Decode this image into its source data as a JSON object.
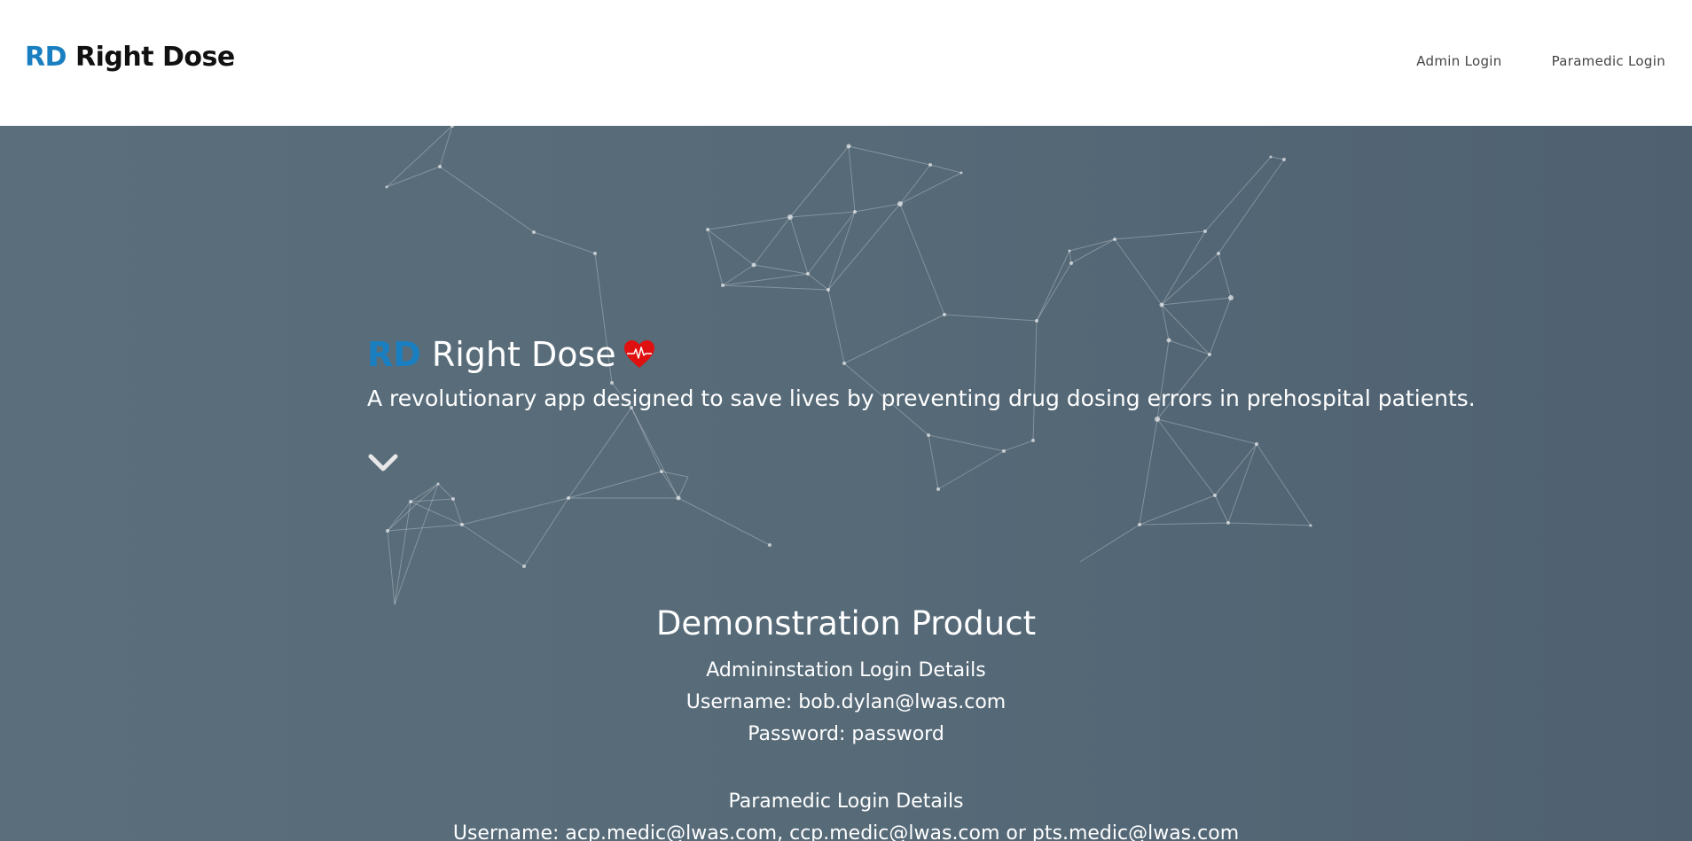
{
  "header": {
    "brand_rd": "RD",
    "brand_name": "Right Dose",
    "nav": {
      "admin_login": "Admin Login",
      "paramedic_login": "Paramedic Login"
    }
  },
  "hero": {
    "title_rd": "RD",
    "title_name": "Right Dose",
    "subtitle": "A revolutionary app designed to save lives by preventing drug dosing errors in prehospital patients."
  },
  "demo": {
    "heading": "Demonstration Product",
    "admin_heading": "Admininstation Login Details",
    "admin_username": "Username: bob.dylan@lwas.com",
    "admin_password": "Password: password",
    "paramedic_heading": "Paramedic Login Details",
    "paramedic_username": "Username: acp.medic@lwas.com, ccp.medic@lwas.com or pts.medic@lwas.com"
  },
  "icons": {
    "heart": "heart-pulse-icon",
    "scroll": "chevron-down-icon"
  },
  "colors": {
    "brand_blue": "#1a7fc1",
    "hero_bg": "#566a78",
    "heart_red": "#e01010"
  }
}
